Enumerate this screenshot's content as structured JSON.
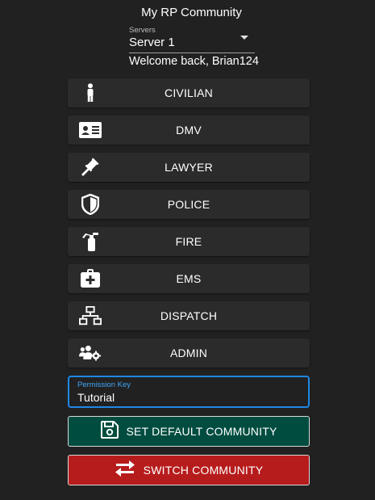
{
  "header": {
    "community_name": "My RP Community",
    "server_label": "Servers",
    "server_value": "Server 1",
    "welcome": "Welcome back, Brian124"
  },
  "departments": [
    {
      "label": "CIVILIAN",
      "icon": "person-icon"
    },
    {
      "label": "DMV",
      "icon": "id-card-icon"
    },
    {
      "label": "LAWYER",
      "icon": "gavel-icon"
    },
    {
      "label": "POLICE",
      "icon": "shield-icon"
    },
    {
      "label": "FIRE",
      "icon": "fire-extinguisher-icon"
    },
    {
      "label": "EMS",
      "icon": "medical-kit-icon"
    },
    {
      "label": "DISPATCH",
      "icon": "network-icon"
    },
    {
      "label": "ADMIN",
      "icon": "users-cog-icon"
    }
  ],
  "permission": {
    "label": "Permission Key",
    "value": "Tutorial"
  },
  "actions": {
    "set_default": "SET DEFAULT COMMUNITY",
    "switch": "SWITCH COMMUNITY"
  },
  "colors": {
    "background": "#212121",
    "button": "#2b2b2b",
    "focus_blue": "#1e88e5",
    "set_default_bg": "#004d40",
    "switch_bg": "#b71c1c"
  }
}
